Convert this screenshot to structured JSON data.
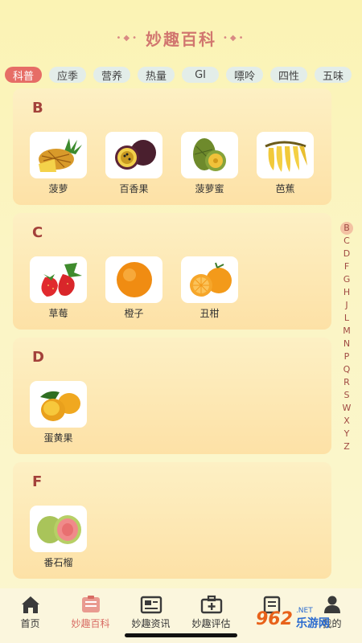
{
  "header": {
    "title": "妙趣百科",
    "deco_left": "•◆•",
    "deco_right": "•◆•"
  },
  "tabs": [
    "科普",
    "应季",
    "营养",
    "热量",
    "GI",
    "嘌呤",
    "四性",
    "五味"
  ],
  "sections": [
    {
      "letter": "B",
      "items": [
        "菠萝",
        "百香果",
        "菠萝蜜",
        "芭蕉"
      ]
    },
    {
      "letter": "C",
      "items": [
        "草莓",
        "橙子",
        "丑柑"
      ]
    },
    {
      "letter": "D",
      "items": [
        "蛋黄果"
      ]
    },
    {
      "letter": "F",
      "items": [
        "番石榴"
      ]
    }
  ],
  "index": [
    "B",
    "C",
    "D",
    "F",
    "G",
    "H",
    "J",
    "L",
    "M",
    "N",
    "P",
    "Q",
    "R",
    "S",
    "W",
    "X",
    "Y",
    "Z"
  ],
  "bottom_nav": [
    "首页",
    "妙趣百科",
    "妙趣资讯",
    "妙趣评估",
    "",
    "我的"
  ],
  "watermark": {
    "logo": "962",
    "cn": "乐游网",
    "en": ".NET"
  },
  "colors": {
    "accent": "#e66d66",
    "title": "#d1766f",
    "letter": "#a3413a"
  }
}
